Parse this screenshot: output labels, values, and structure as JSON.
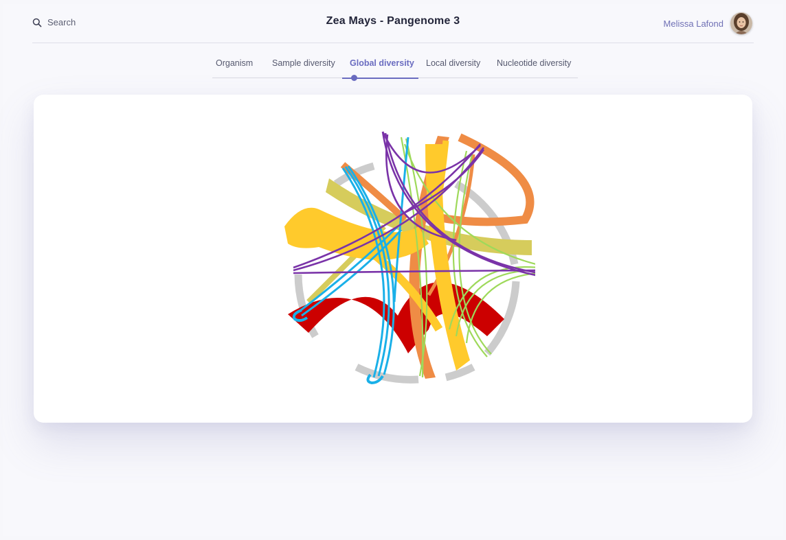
{
  "header": {
    "search_label": "Search",
    "search_icon": "search-icon",
    "title": "Zea Mays - Pangenome 3",
    "user_name": "Melissa Lafond",
    "avatar_icon": "avatar"
  },
  "tabs": [
    {
      "label": "Organism",
      "active": false
    },
    {
      "label": "Sample diversity",
      "active": false
    },
    {
      "label": "Global diversity",
      "active": true
    },
    {
      "label": "Local diversity",
      "active": false
    },
    {
      "label": "Nucleotide diversity",
      "active": false
    }
  ],
  "colors": {
    "accent": "#6a6cc0",
    "ring": "#cccccc",
    "red": "#cc0000",
    "yellow": "#ffca2c",
    "orange": "#ef8c45",
    "olive": "#d6cc5c",
    "blue": "#1ab0e8",
    "green": "#9ed95a",
    "purple": "#7a33a8"
  }
}
